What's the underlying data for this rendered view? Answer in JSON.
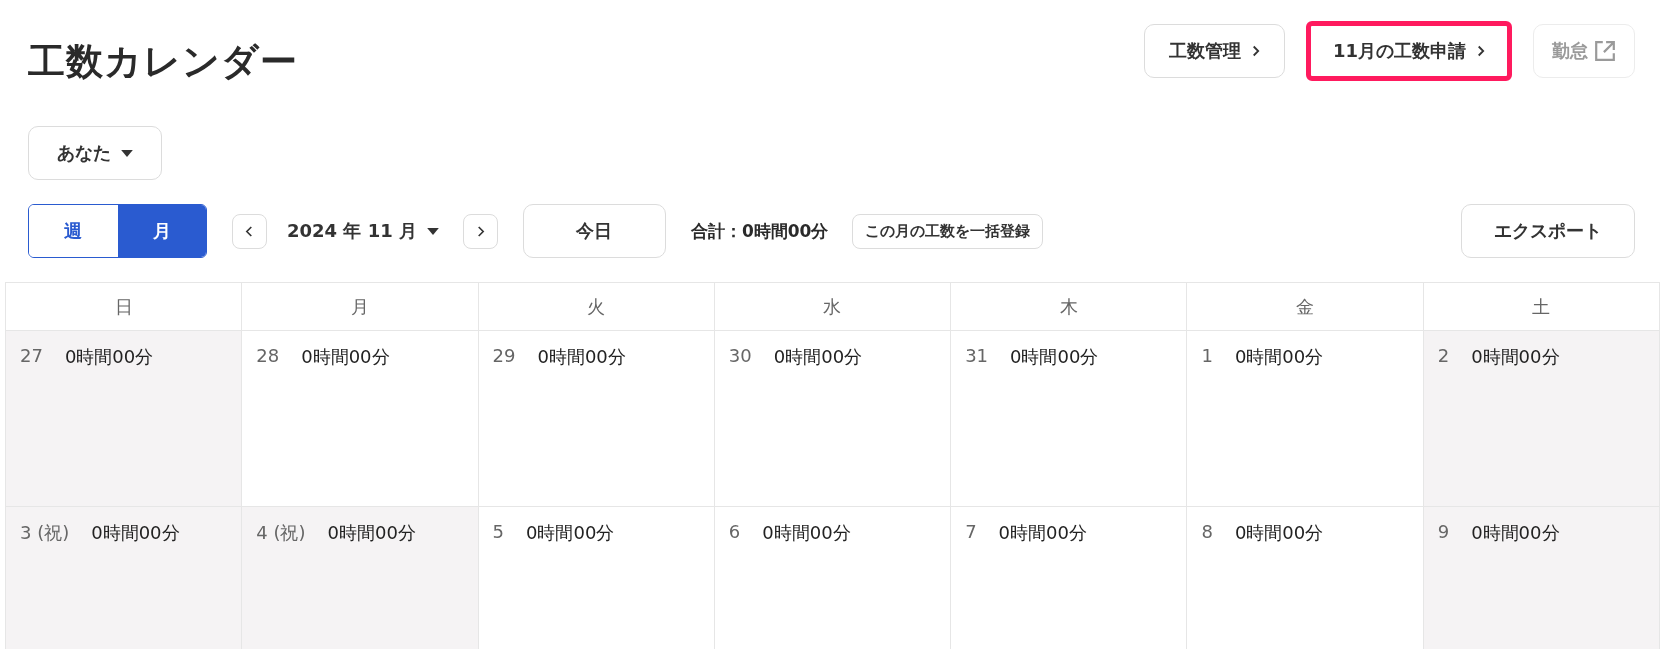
{
  "title": "工数カレンダー",
  "header_buttons": [
    {
      "label": "工数管理",
      "kind": "chevron",
      "highlighted": false,
      "disabled": false
    },
    {
      "label": "11月の工数申請",
      "kind": "chevron",
      "highlighted": true,
      "disabled": false
    },
    {
      "label": "勤怠",
      "kind": "external",
      "highlighted": false,
      "disabled": true
    }
  ],
  "person_select": {
    "value": "あなた"
  },
  "view_toggle": [
    {
      "label": "週",
      "selected": false
    },
    {
      "label": "月",
      "selected": true
    }
  ],
  "month_select": {
    "value": "2024 年 11 月"
  },
  "today_button": "今日",
  "total": "合計：0時間00分",
  "bulk_button": "この月の工数を一括登録",
  "export_button": "エクスポート",
  "calendar": {
    "weekdays": [
      "日",
      "月",
      "火",
      "水",
      "木",
      "金",
      "土"
    ],
    "weeks": [
      [
        {
          "day": "27",
          "hours": "0時間00分",
          "shaded": true
        },
        {
          "day": "28",
          "hours": "0時間00分",
          "shaded": false
        },
        {
          "day": "29",
          "hours": "0時間00分",
          "shaded": false
        },
        {
          "day": "30",
          "hours": "0時間00分",
          "shaded": false
        },
        {
          "day": "31",
          "hours": "0時間00分",
          "shaded": false
        },
        {
          "day": "1",
          "hours": "0時間00分",
          "shaded": false
        },
        {
          "day": "2",
          "hours": "0時間00分",
          "shaded": true
        }
      ],
      [
        {
          "day": "3 (祝)",
          "hours": "0時間00分",
          "shaded": true
        },
        {
          "day": "4 (祝)",
          "hours": "0時間00分",
          "shaded": true
        },
        {
          "day": "5",
          "hours": "0時間00分",
          "shaded": false
        },
        {
          "day": "6",
          "hours": "0時間00分",
          "shaded": false
        },
        {
          "day": "7",
          "hours": "0時間00分",
          "shaded": false
        },
        {
          "day": "8",
          "hours": "0時間00分",
          "shaded": false
        },
        {
          "day": "9",
          "hours": "0時間00分",
          "shaded": true
        }
      ]
    ]
  }
}
